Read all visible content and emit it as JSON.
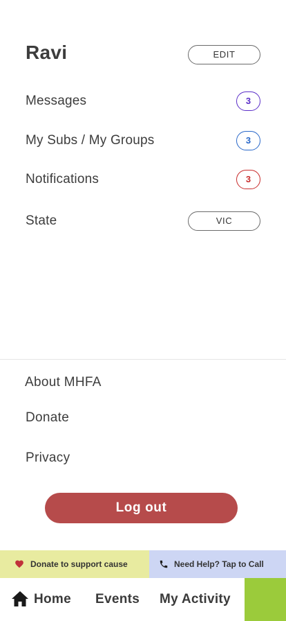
{
  "profile": {
    "name": "Ravi",
    "edit_label": "EDIT"
  },
  "menu": {
    "items": [
      {
        "label": "Messages",
        "count": "3",
        "badge_color": "#5a2dc8"
      },
      {
        "label": "My Subs / My Groups",
        "count": "3",
        "badge_color": "#2867c9"
      },
      {
        "label": "Notifications",
        "count": "3",
        "badge_color": "#c82d2d"
      }
    ],
    "state": {
      "label": "State",
      "value": "VIC"
    }
  },
  "footer_links": {
    "about": "About MHFA",
    "donate": "Donate",
    "privacy": "Privacy"
  },
  "logout_label": "Log out",
  "support_bar": {
    "donate_text": "Donate to support cause",
    "donate_icon": "heart-icon",
    "help_text": "Need Help? Tap to Call",
    "help_icon": "phone-icon",
    "donate_bg": "#e8eba0",
    "help_bg": "#cdd6f4"
  },
  "bottom_nav": {
    "home": "Home",
    "events": "Events",
    "activity": "My Activity",
    "accent_color": "#9bcb3b"
  },
  "colors": {
    "logout": "#b64b4b"
  }
}
